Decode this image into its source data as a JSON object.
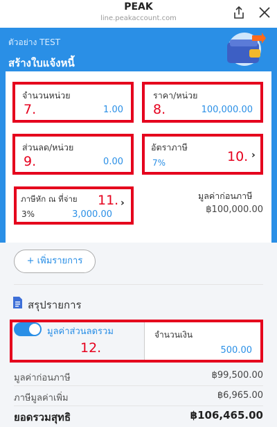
{
  "browser": {
    "title": "PEAK",
    "url": "line.peakaccount.com"
  },
  "header": {
    "subtitle": "ตัวอย่าง TEST",
    "title": "สร้างใบแจ้งหนี้"
  },
  "fields": {
    "quantity": {
      "label": "จำนวนหน่วย",
      "value": "1.00",
      "marker": "7."
    },
    "price": {
      "label": "ราคา/หน่วย",
      "value": "100,000.00",
      "marker": "8."
    },
    "discount": {
      "label": "ส่วนลด/หน่วย",
      "value": "0.00",
      "marker": "9."
    },
    "tax_rate": {
      "label": "อัตราภาษี",
      "value": "7%",
      "marker": "10."
    },
    "withholding": {
      "label": "ภาษีหัก ณ ที่จ่าย",
      "rate": "3%",
      "value": "3,000.00",
      "marker": "11."
    },
    "pretax": {
      "label": "มูลค่าก่อนภาษี",
      "value": "฿100,000.00"
    }
  },
  "add_item": {
    "label": "+ เพิ่มรายการ"
  },
  "summary": {
    "title": "สรุปรายการ",
    "discount_toggle": {
      "label": "มูลค่าส่วนลดรวม",
      "on": true
    },
    "amount": {
      "label": "จำนวนเงิน",
      "value": "500.00"
    },
    "marker": "12.",
    "rows": [
      {
        "label": "มูลค่าก่อนภาษี",
        "value": "฿99,500.00"
      },
      {
        "label": "ภาษีมูลค่าเพิ่ม",
        "value": "฿6,965.00"
      }
    ],
    "total": {
      "label": "ยอดรวมสุทธิ",
      "value": "฿106,465.00"
    }
  },
  "colors": {
    "primary": "#2a8fe6",
    "annotation": "#e5001d"
  }
}
